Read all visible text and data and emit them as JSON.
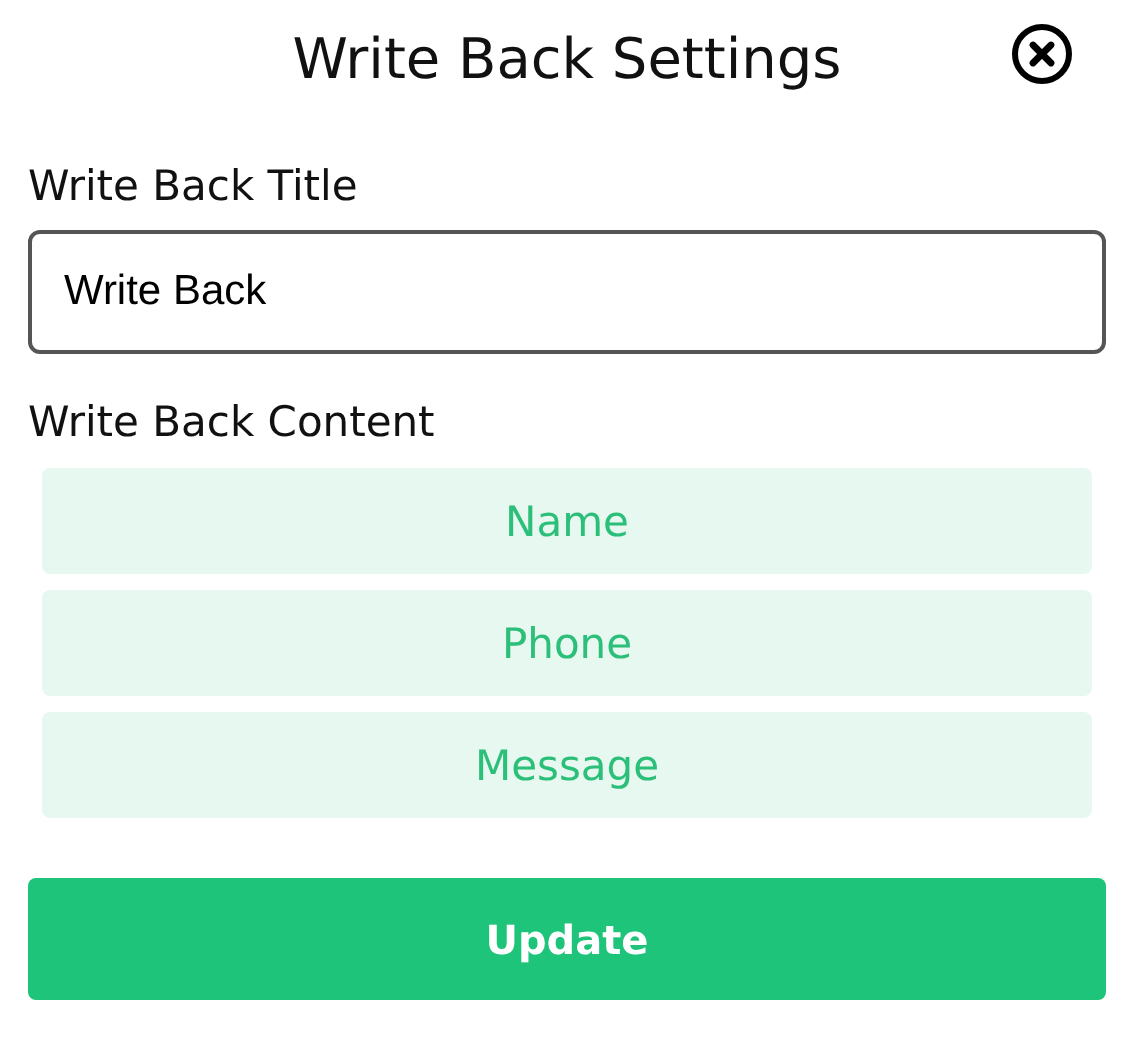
{
  "dialog": {
    "title": "Write Back Settings"
  },
  "title_field": {
    "label": "Write Back Title",
    "value": "Write Back"
  },
  "content": {
    "label": "Write Back Content",
    "items": [
      {
        "label": "Name"
      },
      {
        "label": "Phone"
      },
      {
        "label": "Message"
      }
    ]
  },
  "buttons": [
    "Update"
  ]
}
